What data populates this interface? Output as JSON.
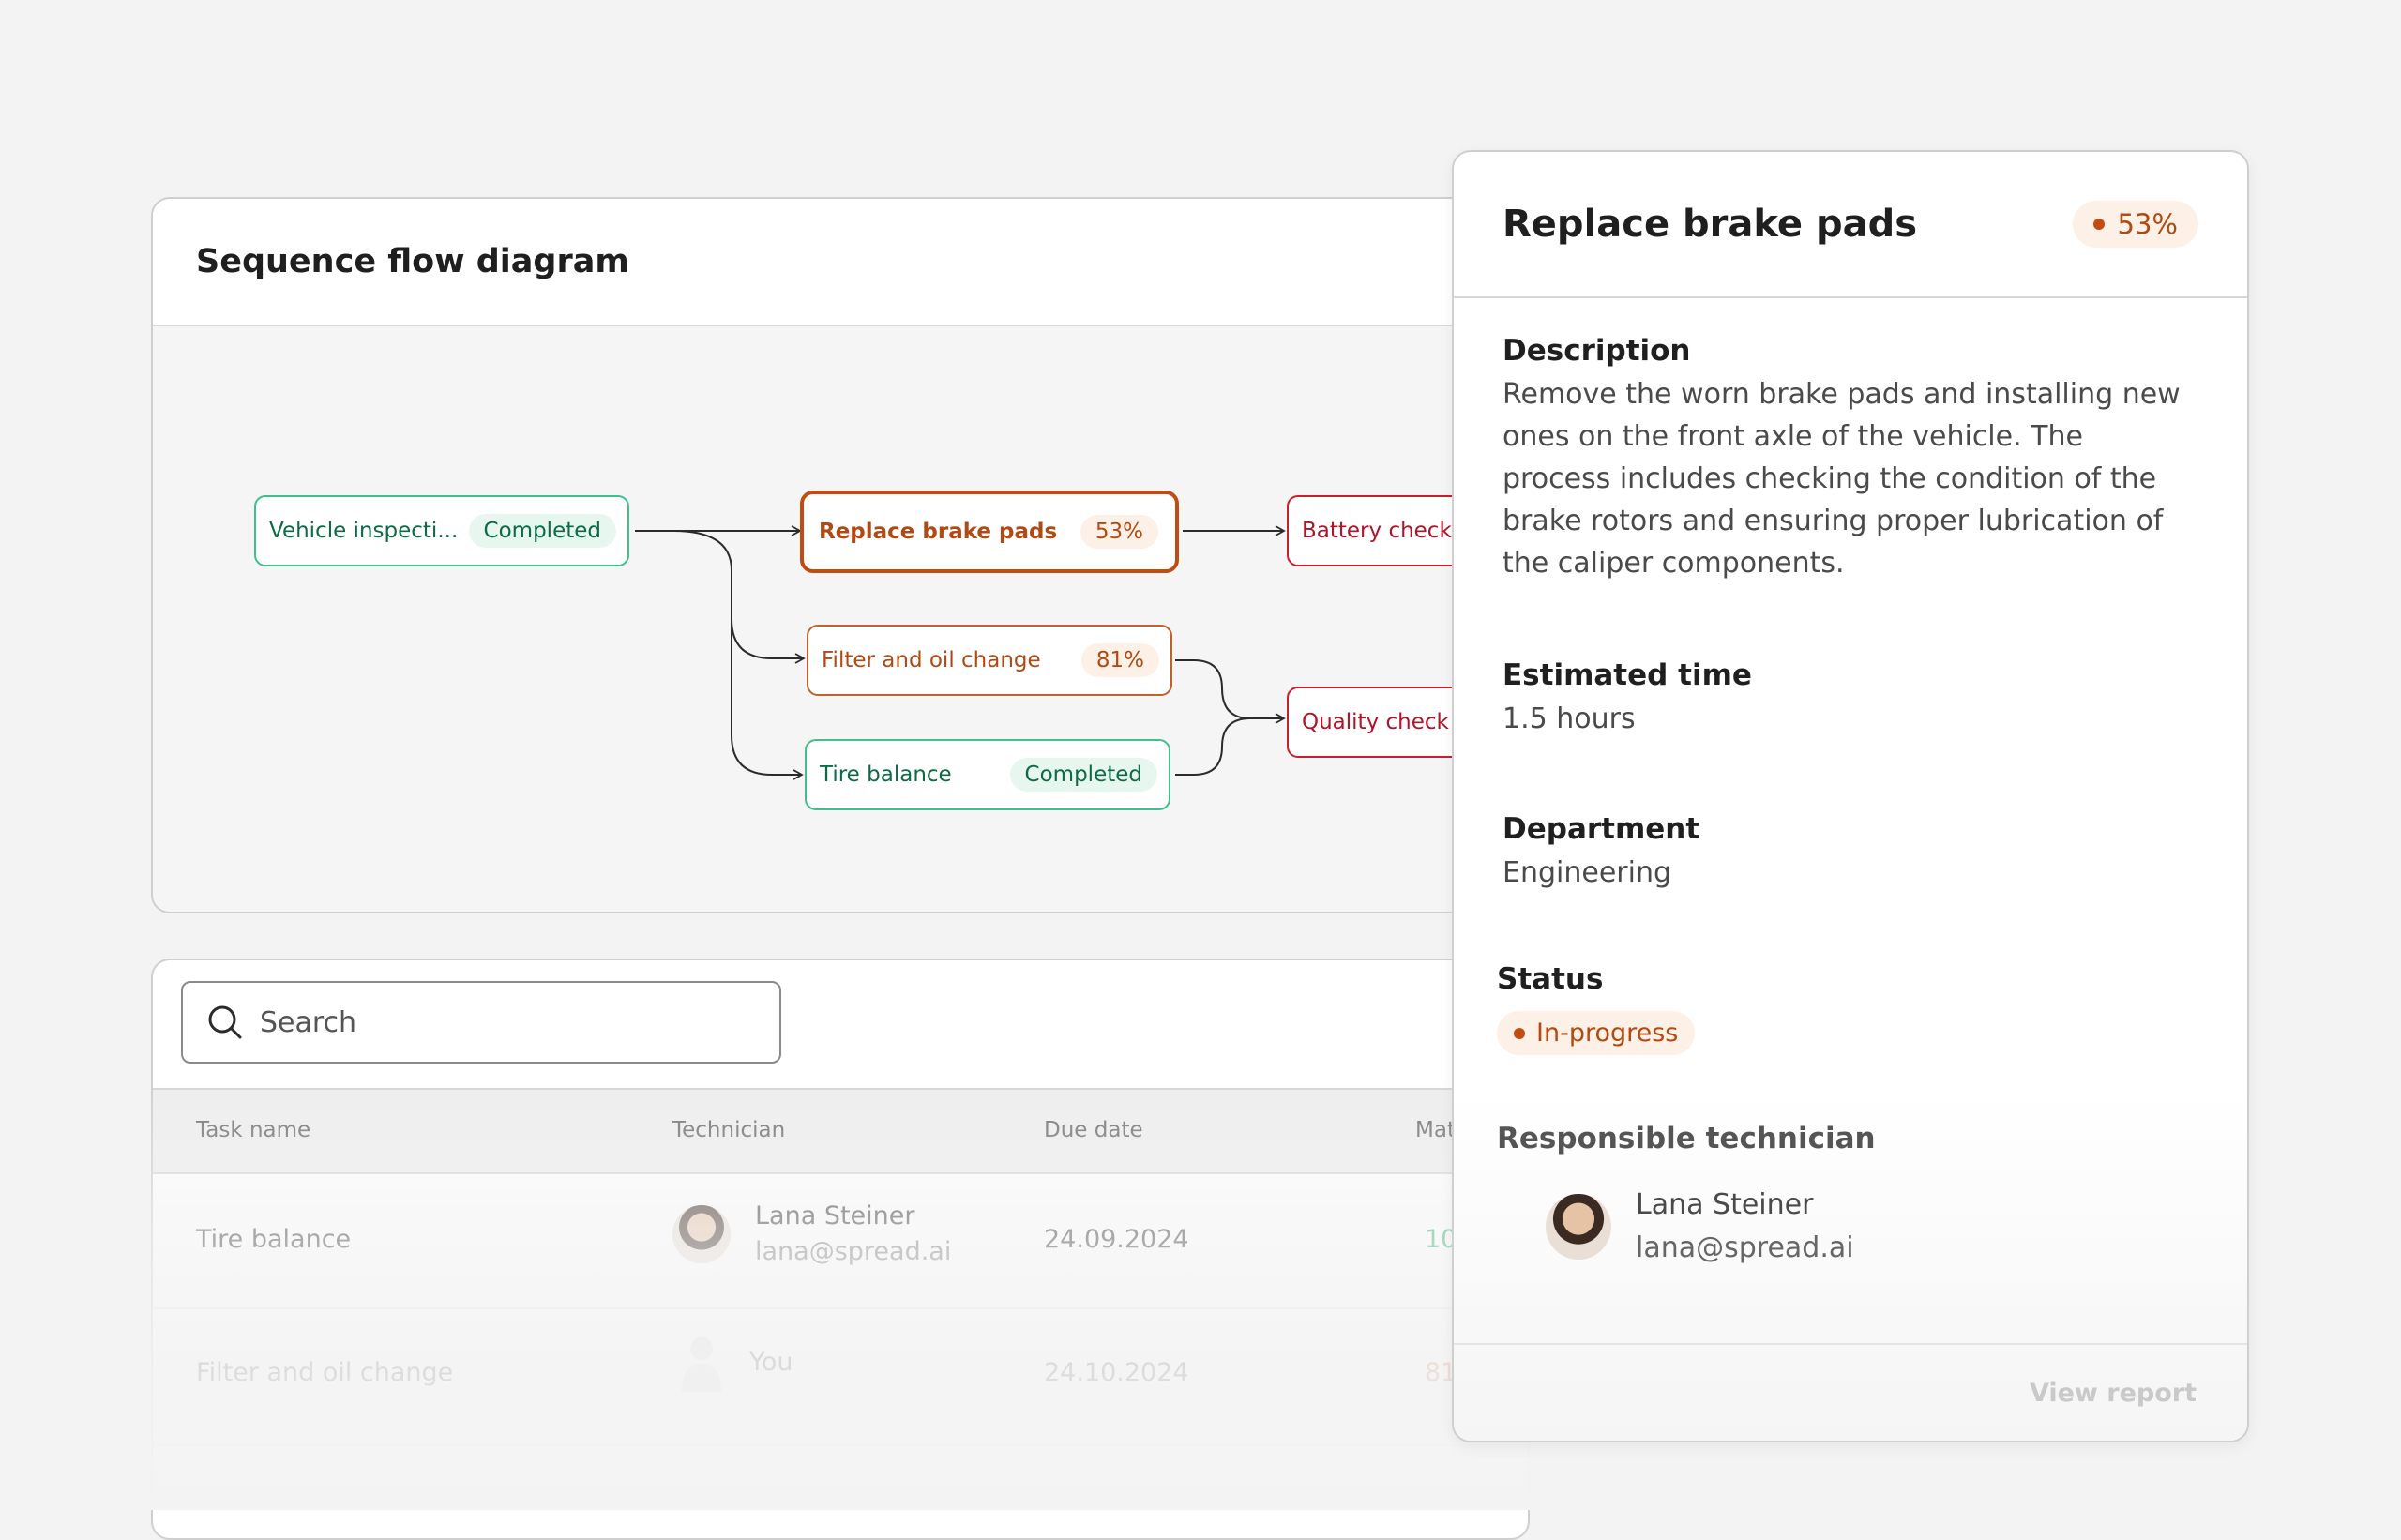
{
  "flow": {
    "title": "Sequence flow diagram",
    "nodes": {
      "vehicle_inspection": {
        "label": "Vehicle inspecti...",
        "status": "Completed"
      },
      "replace_brake_pads": {
        "label": "Replace brake pads",
        "progress": "53%"
      },
      "filter_oil_change": {
        "label": "Filter and oil change",
        "progress": "81%"
      },
      "tire_balance": {
        "label": "Tire balance",
        "status": "Completed"
      },
      "battery_check": {
        "label": "Battery check"
      },
      "quality_check": {
        "label": "Quality check"
      }
    }
  },
  "table": {
    "search_placeholder": "Search",
    "columns": [
      "Task name",
      "Technician",
      "Due date",
      "Mat"
    ],
    "rows": [
      {
        "task": "Tire balance",
        "tech_name": "Lana Steiner",
        "tech_email": "lana@spread.ai",
        "due": "24.09.2024",
        "progress": "10"
      },
      {
        "task": "Filter and oil change",
        "tech_name": "You",
        "tech_email": "",
        "due": "24.10.2024",
        "progress": "81"
      }
    ]
  },
  "detail": {
    "title": "Replace brake pads",
    "progress": "53%",
    "description_label": "Description",
    "description": "Remove the worn brake pads and installing new ones on the front axle of the vehicle. The process includes checking the condition of the brake rotors and ensuring proper lubrication of the caliper components.",
    "time_label": "Estimated time",
    "time_value": "1.5 hours",
    "department_label": "Department",
    "department_value": "Engineering",
    "status_label": "Status",
    "status_value": "In-progress",
    "technician_label": "Responsible technician",
    "technician_name": "Lana Steiner",
    "technician_email": "lana@spread.ai",
    "footer_button": "View report"
  },
  "colors": {
    "completed": "#0d6b43",
    "in_progress": "#b14a12",
    "pending": "#b01428"
  }
}
